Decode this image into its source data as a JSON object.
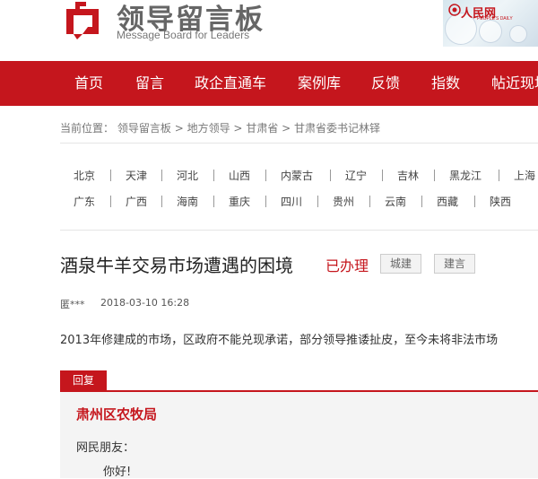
{
  "header": {
    "brand_title": "领导留言板",
    "brand_subtitle": "Message Board for Leaders",
    "partner_logo": "人民网",
    "partner_logo_sub": "PEOPLE'S DAILY"
  },
  "nav": {
    "items": [
      "首页",
      "留言",
      "政企直通车",
      "案例库",
      "反馈",
      "指数",
      "帖近现场"
    ]
  },
  "breadcrumb": {
    "prefix": "当前位置：",
    "items": [
      "领导留言板",
      "地方领导",
      "甘肃省",
      "甘肃省委书记林铎"
    ],
    "sep": ">"
  },
  "provinces": {
    "row1": [
      "北京",
      "天津",
      "河北",
      "山西",
      "内蒙古",
      "辽宁",
      "吉林",
      "黑龙江",
      "上海"
    ],
    "row2": [
      "广东",
      "广西",
      "海南",
      "重庆",
      "四川",
      "贵州",
      "云南",
      "西藏",
      "陕西"
    ]
  },
  "message": {
    "title": "酒泉牛羊交易市场遭遇的困境",
    "status": "已办理",
    "tags": [
      "城建",
      "建言"
    ],
    "author": "匿***",
    "datetime": "2018-03-10 16:28",
    "content": "2013年修建成的市场，区政府不能兑现承诺，部分领导推诿扯皮，至今未将非法市场"
  },
  "reply": {
    "tab_label": "回复",
    "organization": "肃州区农牧局",
    "greeting": "网民朋友：",
    "hello": "你好!"
  },
  "colors": {
    "accent": "#c5161d",
    "nav_bg": "#c5161d"
  }
}
